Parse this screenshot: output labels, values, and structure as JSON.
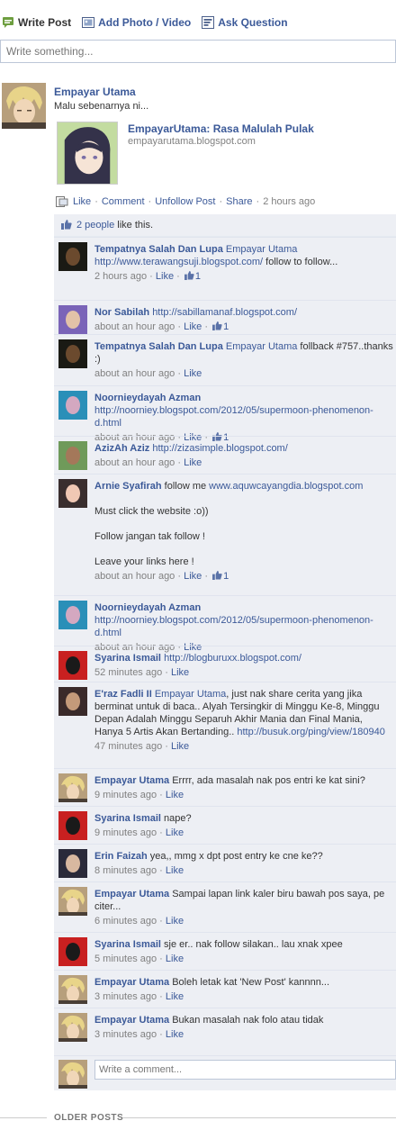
{
  "composer": {
    "tabs": [
      {
        "label": "Write Post",
        "icon": "status-icon"
      },
      {
        "label": "Add Photo / Video",
        "icon": "photo-icon"
      },
      {
        "label": "Ask Question",
        "icon": "question-icon"
      }
    ],
    "placeholder": "Write something..."
  },
  "post": {
    "author": "Empayar Utama",
    "text": "Malu sebenarnya ni...",
    "share_title": "EmpayarUtama: Rasa Malulah Pulak",
    "share_url": "empayarutama.blogspot.com",
    "actions": {
      "like": "Like",
      "comment": "Comment",
      "unfollow": "Unfollow Post",
      "share": "Share",
      "time": "2 hours ago"
    },
    "likes_count_link": "2 people",
    "likes_suffix": " like this."
  },
  "comments": [
    {
      "name": "Tempatnya Salah Dan Lupa",
      "text_parts": [
        {
          "t": " "
        },
        {
          "l": "Empayar Utama"
        },
        {
          "t": " "
        },
        {
          "l": "http://www.terawangsuji.blogspot.com/"
        },
        {
          "t": " follow to follow..."
        }
      ],
      "time": "2 hours ago",
      "like": "Like",
      "likes": "1"
    },
    {
      "name": "Nor Sabilah",
      "text_parts": [
        {
          "t": " "
        },
        {
          "l": "http://sabillamanaf.blogspot.com/"
        }
      ],
      "time": "about an hour ago",
      "like": "Like",
      "likes": "1"
    },
    {
      "name": "Tempatnya Salah Dan Lupa",
      "text_parts": [
        {
          "t": " "
        },
        {
          "l": "Empayar Utama"
        },
        {
          "t": " follback #757..thanks :)"
        }
      ],
      "time": "about an hour ago",
      "like": "Like",
      "likes": ""
    },
    {
      "name": "Noornieydayah Azman",
      "text_parts": [
        {
          "t": " "
        },
        {
          "l": "http://noorniey.blogspot.com/2012/05/supermoon-phenomenon-d.html"
        }
      ],
      "time": "about an hour ago",
      "like": "Like",
      "likes": "1"
    },
    {
      "name": "AzizAh Aziz",
      "text_parts": [
        {
          "t": " "
        },
        {
          "l": "http://zizasimple.blogspot.com/"
        }
      ],
      "time": "about an hour ago",
      "like": "Like",
      "likes": ""
    },
    {
      "name": "Arnie Syafirah",
      "text_parts": [
        {
          "t": " follow me "
        },
        {
          "l": "www.aquwcayangdia.blogspot.com"
        },
        {
          "br": 2
        },
        {
          "t": "Must click the website :o))"
        },
        {
          "br": 2
        },
        {
          "t": "Follow jangan tak follow !"
        },
        {
          "br": 2
        },
        {
          "t": "Leave your links here !"
        }
      ],
      "time": "about an hour ago",
      "like": "Like",
      "likes": "1"
    },
    {
      "name": "Noornieydayah Azman",
      "text_parts": [
        {
          "t": " "
        },
        {
          "l": "http://noorniey.blogspot.com/2012/05/supermoon-phenomenon-d.html"
        }
      ],
      "time": "about an hour ago",
      "like": "Like",
      "likes": ""
    },
    {
      "name": "Syarina Ismail",
      "text_parts": [
        {
          "t": " "
        },
        {
          "l": "http://blogburuxx.blogspot.com/"
        }
      ],
      "time": "52 minutes ago",
      "like": "Like",
      "likes": ""
    },
    {
      "name": "E'raz Fadli II",
      "text_parts": [
        {
          "t": " "
        },
        {
          "l": "Empayar Utama"
        },
        {
          "t": ", just nak share cerita yang jika berminat untuk di baca.. Alyah Tersingkir di Minggu Ke-8, Minggu Depan Adalah Minggu Separuh Akhir Mania dan Final Mania, Hanya 5 Artis Akan Bertanding.. "
        },
        {
          "l": "http://busuk.org/ping/view/180940"
        }
      ],
      "time": "47 minutes ago",
      "like": "Like",
      "likes": ""
    },
    {
      "name": "Empayar Utama",
      "text_parts": [
        {
          "t": " Errrr, ada masalah nak pos entri ke kat sini?"
        }
      ],
      "time": "9 minutes ago",
      "like": "Like",
      "likes": ""
    },
    {
      "name": "Syarina Ismail",
      "text_parts": [
        {
          "t": " nape?"
        }
      ],
      "time": "9 minutes ago",
      "like": "Like",
      "likes": ""
    },
    {
      "name": "Erin Faizah",
      "text_parts": [
        {
          "t": " yea,, mmg x dpt post entry ke cne ke??"
        }
      ],
      "time": "8 minutes ago",
      "like": "Like",
      "likes": ""
    },
    {
      "name": "Empayar Utama",
      "text_parts": [
        {
          "t": " Sampai lapan link kaler biru bawah pos saya, pe citer..."
        }
      ],
      "time": "6 minutes ago",
      "like": "Like",
      "likes": ""
    },
    {
      "name": "Syarina Ismail",
      "text_parts": [
        {
          "t": " sje er.. nak follow silakan.. lau xnak xpee"
        }
      ],
      "time": "5 minutes ago",
      "like": "Like",
      "likes": ""
    },
    {
      "name": "Empayar Utama",
      "text_parts": [
        {
          "t": " Boleh letak kat 'New Post' kannnn..."
        }
      ],
      "time": "3 minutes ago",
      "like": "Like",
      "likes": ""
    },
    {
      "name": "Empayar Utama",
      "text_parts": [
        {
          "t": " Bukan masalah nak folo atau tidak"
        }
      ],
      "time": "3 minutes ago",
      "like": "Like",
      "likes": ""
    }
  ],
  "reply_placeholder": "Write a comment...",
  "older_posts": "OLDER POSTS",
  "colors": {
    "link": "#3b5998",
    "comment_bg": "#edeff4",
    "meta": "#808080"
  }
}
